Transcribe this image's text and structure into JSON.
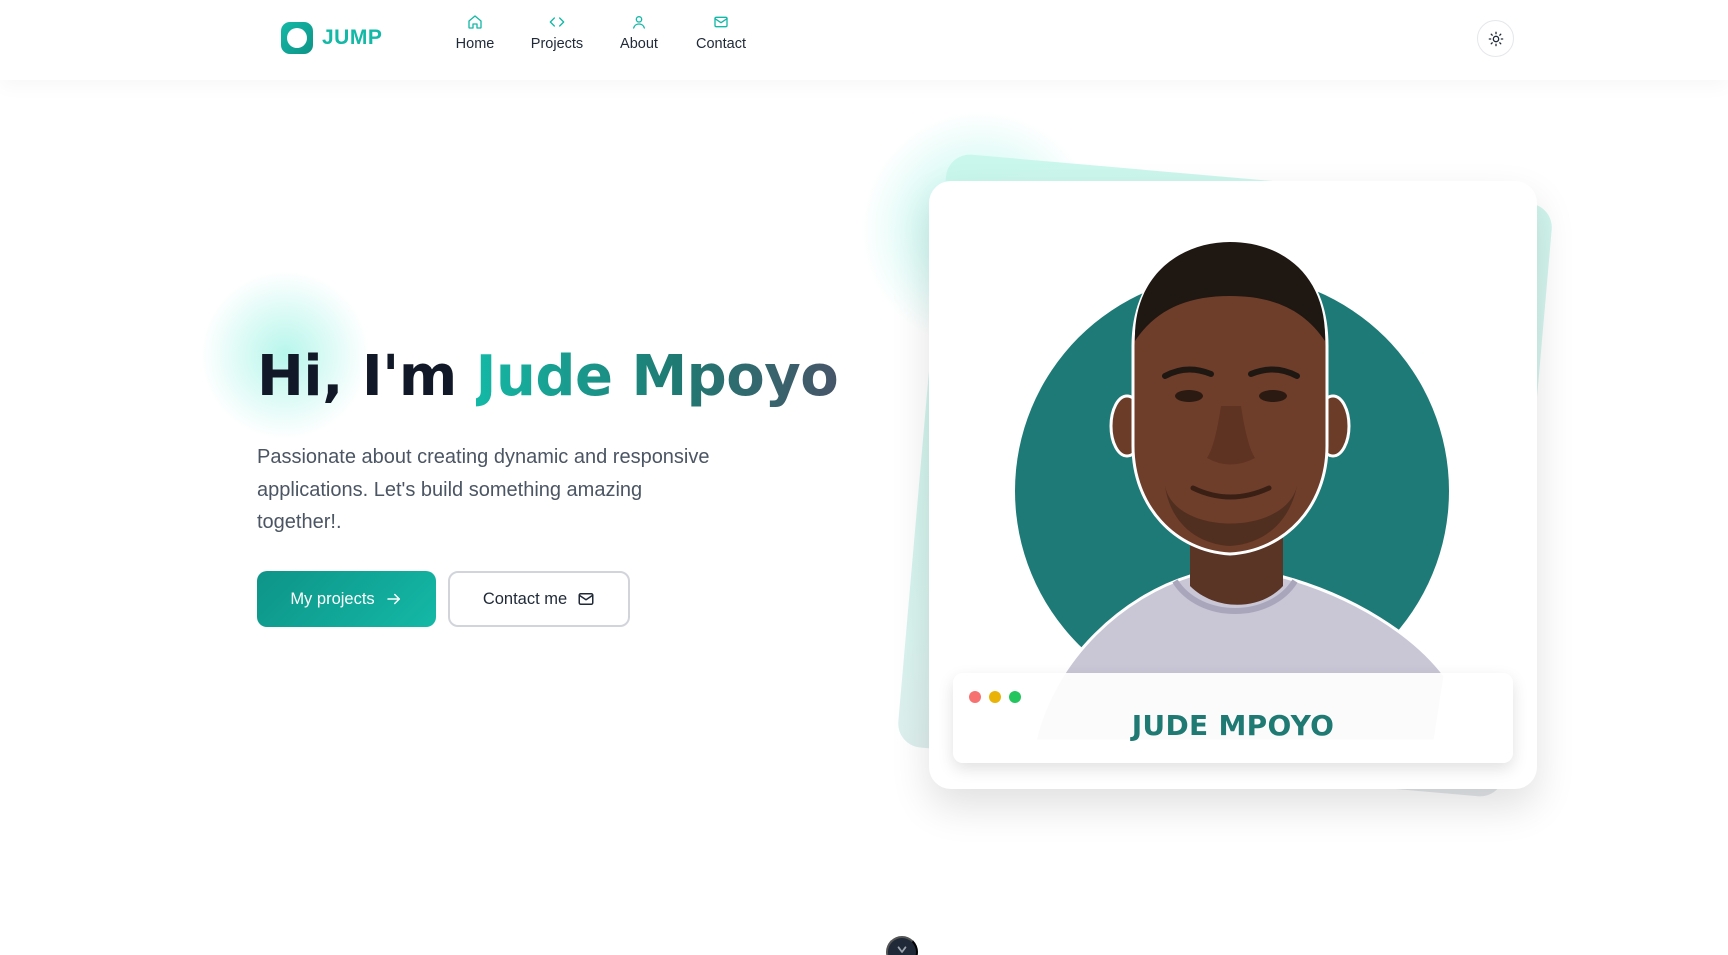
{
  "header": {
    "logo_text": "JUMP",
    "nav": [
      {
        "label": "Home",
        "icon": "home-icon"
      },
      {
        "label": "Projects",
        "icon": "code-icon"
      },
      {
        "label": "About",
        "icon": "user-icon"
      },
      {
        "label": "Contact",
        "icon": "mail-icon"
      }
    ],
    "theme_toggle_icon": "sun-icon"
  },
  "hero": {
    "greeting": "Hi, I'm ",
    "name": "Jude Mpoyo",
    "intro": "Passionate about creating dynamic and responsive applications. Let's build something amazing together!.",
    "primary_button": {
      "label": "My projects",
      "icon": "arrow-right-icon"
    },
    "secondary_button": {
      "label": "Contact me",
      "icon": "mail-icon"
    }
  },
  "profile_card": {
    "name_plate": "JUDE MPOYO",
    "dots": [
      "#f87171",
      "#eab308",
      "#22c55e"
    ]
  },
  "scroll_indicator_icon": "chevron-down-icon",
  "colors": {
    "accent": "#14b8a6",
    "accent_dark": "#0d9488",
    "circle": "#1d7a77",
    "name_plate_text": "#1f7a73"
  }
}
